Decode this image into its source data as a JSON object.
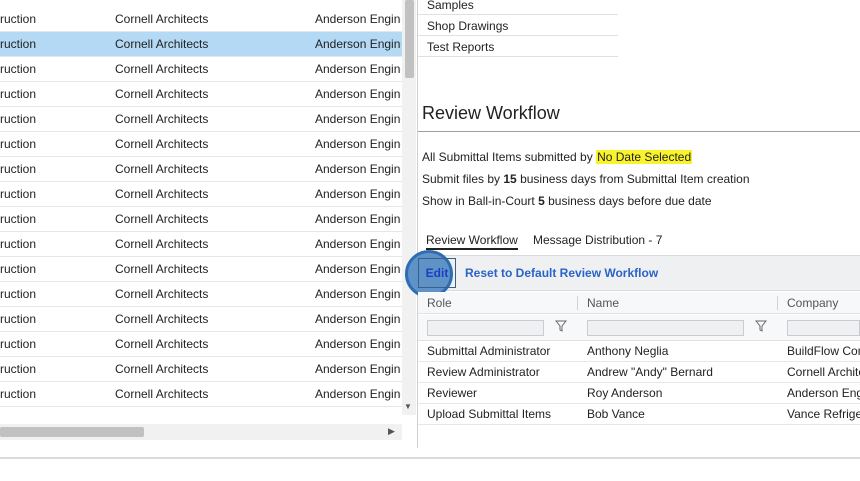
{
  "left_grid": {
    "rows": [
      {
        "c1": "ruction",
        "c2": "Cornell Architects",
        "c3": "Anderson Engineering",
        "selected": false
      },
      {
        "c1": "ruction",
        "c2": "Cornell Architects",
        "c3": "Anderson Engineering",
        "selected": true
      },
      {
        "c1": "ruction",
        "c2": "Cornell Architects",
        "c3": "Anderson Engineering",
        "selected": false
      },
      {
        "c1": "ruction",
        "c2": "Cornell Architects",
        "c3": "Anderson Engineering",
        "selected": false
      },
      {
        "c1": "ruction",
        "c2": "Cornell Architects",
        "c3": "Anderson Engineering",
        "selected": false
      },
      {
        "c1": "ruction",
        "c2": "Cornell Architects",
        "c3": "Anderson Engineering",
        "selected": false
      },
      {
        "c1": "ruction",
        "c2": "Cornell Architects",
        "c3": "Anderson Engineering",
        "selected": false
      },
      {
        "c1": "ruction",
        "c2": "Cornell Architects",
        "c3": "Anderson Engineering",
        "selected": false
      },
      {
        "c1": "ruction",
        "c2": "Cornell Architects",
        "c3": "Anderson Engineering",
        "selected": false
      },
      {
        "c1": "ruction",
        "c2": "Cornell Architects",
        "c3": "Anderson Engineering",
        "selected": false
      },
      {
        "c1": "ruction",
        "c2": "Cornell Architects",
        "c3": "Anderson Engineering",
        "selected": false
      },
      {
        "c1": "ruction",
        "c2": "Cornell Architects",
        "c3": "Anderson Engineering",
        "selected": false
      },
      {
        "c1": "ruction",
        "c2": "Cornell Architects",
        "c3": "Anderson Engineering",
        "selected": false
      },
      {
        "c1": "ruction",
        "c2": "Cornell Architects",
        "c3": "Anderson Engineering",
        "selected": false
      },
      {
        "c1": "ruction",
        "c2": "Cornell Architects",
        "c3": "Anderson Engineering",
        "selected": false
      },
      {
        "c1": "ruction",
        "c2": "Cornell Architects",
        "c3": "Anderson Engineering",
        "selected": false
      }
    ]
  },
  "top_list": [
    "Samples",
    "Shop Drawings",
    "Test Reports"
  ],
  "review_workflow": {
    "title": "Review Workflow",
    "line1_prefix": "All Submittal Items submitted by",
    "line1_highlight": "No Date Selected",
    "line2_prefix": "Submit files by",
    "line2_bold": "15",
    "line2_suffix": "business days from Submittal Item creation",
    "line3_prefix": "Show in Ball-in-Court",
    "line3_bold": "5",
    "line3_suffix": "business days before due date",
    "tabs": {
      "review": "Review Workflow",
      "message": "Message Distribution - 7"
    },
    "toolbar": {
      "edit": "Edit",
      "reset": "Reset to Default Review Workflow"
    },
    "columns": {
      "role": "Role",
      "name": "Name",
      "company": "Company"
    },
    "rows": [
      {
        "role": "Submittal Administrator",
        "name": "Anthony Neglia",
        "company": "BuildFlow Construction"
      },
      {
        "role": "Review Administrator",
        "name": "Andrew \"Andy\" Bernard",
        "company": "Cornell Architects"
      },
      {
        "role": "Reviewer",
        "name": "Roy Anderson",
        "company": "Anderson Engineering"
      },
      {
        "role": "Upload Submittal Items",
        "name": "Bob Vance",
        "company": "Vance Refrigeration"
      }
    ]
  },
  "colors": {
    "selected_row": "#b3d9f5",
    "highlight": "#f8f32b",
    "link": "#2b63c6",
    "focus_ring": "#2f6db1"
  }
}
